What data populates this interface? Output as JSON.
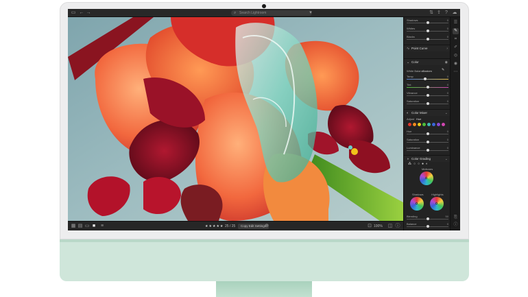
{
  "search": {
    "placeholder": "Search Lightroom"
  },
  "bottombar": {
    "rating": "★★★★★",
    "filter_label": "25 / 25",
    "copy_settings": "Copy Edit Settings",
    "zoom": "100%"
  },
  "panel": {
    "top_sliders": [
      {
        "label": "Shadows",
        "value": "0",
        "level": 0.5
      },
      {
        "label": "Whites",
        "value": "0",
        "level": 0.5
      },
      {
        "label": "Blacks",
        "value": "0",
        "level": 0.5
      }
    ],
    "point_curve": "Point Curve",
    "color": {
      "title": "Color",
      "white_balance_label": "White Balance",
      "white_balance_value": "Custom",
      "sliders": [
        {
          "label": "Temp",
          "value": "0",
          "level": 0.45
        },
        {
          "label": "Tint",
          "value": "0",
          "level": 0.5
        },
        {
          "label": "Vibrance",
          "value": "0",
          "level": 0.5
        },
        {
          "label": "Saturation",
          "value": "0",
          "level": 0.5
        }
      ]
    },
    "color_mixer": {
      "title": "Color Mixer",
      "adjust_label": "Adjust",
      "adjust_value": "Hue",
      "swatches": [
        "#e2372b",
        "#f08a1e",
        "#e8c81a",
        "#4cbf3a",
        "#3fb8b0",
        "#3a66d8",
        "#8a48d0",
        "#d046b0"
      ],
      "sliders": [
        {
          "label": "Hue",
          "value": "0",
          "level": 0.5
        },
        {
          "label": "Saturation",
          "value": "0",
          "level": 0.5
        },
        {
          "label": "Luminance",
          "value": "0",
          "level": 0.5
        }
      ]
    },
    "color_grading": {
      "title": "Color Grading",
      "midtones": "Midtones",
      "shadows": "Shadows",
      "highlights": "Highlights",
      "sliders": [
        {
          "label": "Blending",
          "value": "50",
          "level": 0.5
        },
        {
          "label": "Balance",
          "value": "0",
          "level": 0.5
        }
      ]
    }
  },
  "colors": {
    "accent": "#6ac5ff",
    "chin": "#cfe6da",
    "panel_bg": "#232323"
  }
}
